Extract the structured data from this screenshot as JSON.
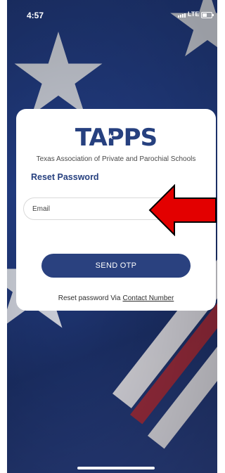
{
  "status_bar": {
    "time": "4:57",
    "network": "LTE"
  },
  "app": {
    "logo_text": "TAPPS",
    "org_name": "Texas Association of Private and Parochial Schools",
    "brand_color": "#26407f"
  },
  "form": {
    "heading": "Reset Password",
    "email_placeholder": "Email",
    "send_label": "SEND OTP"
  },
  "footer": {
    "prefix": "Reset password Via",
    "link_label": "Contact Number"
  },
  "annotation": {
    "arrow_color": "#e30000"
  }
}
